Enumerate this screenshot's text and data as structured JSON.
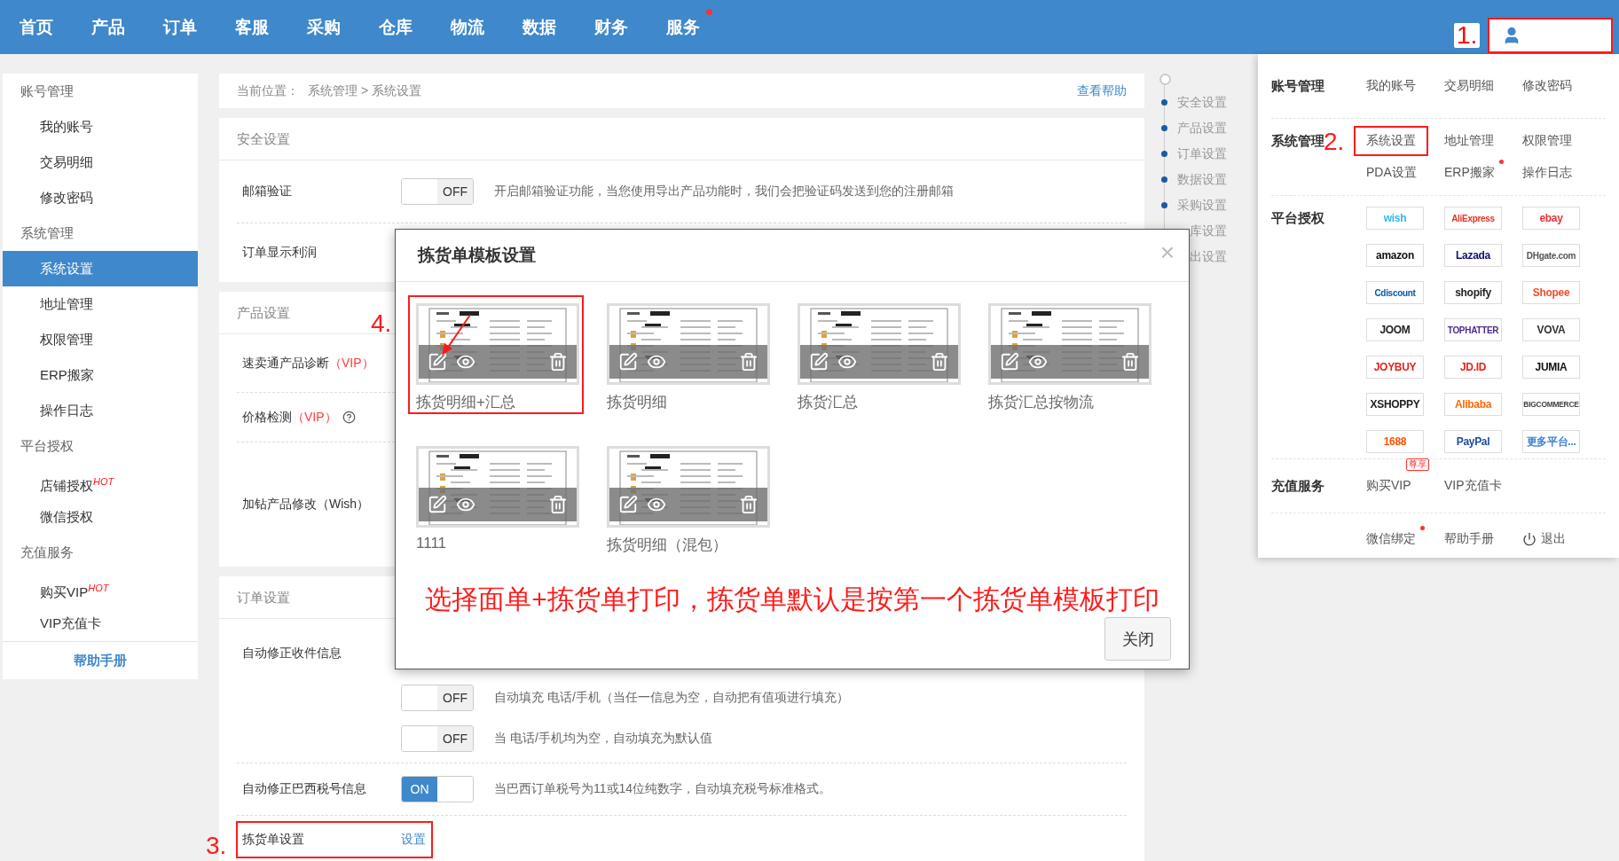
{
  "nav": {
    "items": [
      {
        "label": "首页"
      },
      {
        "label": "产品"
      },
      {
        "label": "订单"
      },
      {
        "label": "客服"
      },
      {
        "label": "采购"
      },
      {
        "label": "仓库"
      },
      {
        "label": "物流"
      },
      {
        "label": "数据"
      },
      {
        "label": "财务"
      },
      {
        "label": "服务",
        "dot": true
      }
    ],
    "user": {
      "annotation": "1."
    }
  },
  "sidebar": {
    "groups": [
      {
        "title": "账号管理",
        "items": [
          {
            "label": "我的账号",
            "selected": false
          },
          {
            "label": "交易明细",
            "selected": false
          },
          {
            "label": "修改密码",
            "selected": false
          }
        ]
      },
      {
        "title": "系统管理",
        "items": [
          {
            "label": "系统设置",
            "selected": true
          },
          {
            "label": "地址管理",
            "selected": false
          },
          {
            "label": "权限管理",
            "selected": false
          },
          {
            "label": "ERP搬家",
            "selected": false
          },
          {
            "label": "操作日志",
            "selected": false
          }
        ]
      },
      {
        "title": "平台授权",
        "items": [
          {
            "label": "店铺授权$^{HOT}$",
            "selected": false
          },
          {
            "label": "微信授权",
            "selected": false
          }
        ]
      },
      {
        "title": "充值服务",
        "items": [
          {
            "label": "购买VIP$^{HOT}$",
            "selected": false
          },
          {
            "label": "VIP充值卡",
            "selected": false
          }
        ]
      }
    ],
    "footer": "帮助手册"
  },
  "breadcrumb": {
    "prefix": "当前位置：",
    "path": "系统管理 > 系统设置",
    "help": "查看帮助"
  },
  "sections": [
    {
      "title": "安全设置",
      "rows": [
        {
          "label": "邮箱验证",
          "options": [
            {
              "toggle": {
                "on": false,
                "text": "OFF"
              },
              "description": "开启邮箱验证功能，当您使用导出产品功能时，我们会把验证码发送到您的注册邮箱"
            }
          ]
        },
        {
          "label": "订单显示利润"
        }
      ]
    },
    {
      "title": "产品设置",
      "rows": [
        {
          "label": "速卖通产品诊断",
          "tag": "（VIP）"
        },
        {
          "label": "价格检测",
          "tag": "（VIP）",
          "help": true
        },
        {
          "label": "加钻产品修改（Wish）"
        }
      ]
    },
    {
      "title": "订单设置",
      "rows": [
        {
          "label": "自动修正收件信息",
          "options": [
            {
              "toggle": {
                "on": false,
                "text": "OFF"
              },
              "description": "自动填充 电话/手机（当任一信息为空，自动把有值项进行填充）"
            },
            {
              "toggle": {
                "on": false,
                "text": "OFF"
              },
              "description": "当 电话/手机均为空，自动填充为默认值"
            }
          ]
        },
        {
          "label": "自动修正巴西税号信息",
          "options": [
            {
              "toggle": {
                "on": true,
                "text": "ON"
              },
              "description": "当巴西订单税号为11或14位纯数字，自动填充税号标准格式。"
            }
          ]
        },
        {
          "label": "拣货单设置",
          "link": "设置",
          "annotation": "3."
        }
      ]
    }
  ],
  "right_nav": {
    "items": [
      {
        "label": "安全设置",
        "covered": false
      },
      {
        "label": "产品设置",
        "covered": false
      },
      {
        "label": "订单设置",
        "covered": false
      },
      {
        "label": "数据设置",
        "covered": false
      },
      {
        "label": "采购设置",
        "covered": false
      },
      {
        "label": "库设置",
        "covered": true
      },
      {
        "label": "出设置",
        "covered": true
      }
    ]
  },
  "modal": {
    "title": "拣货单模板设置",
    "close": "×",
    "templates": [
      {
        "name": "拣货明细+汇总",
        "annotation": "4."
      },
      {
        "name": "拣货明细"
      },
      {
        "name": "拣货汇总"
      },
      {
        "name": "拣货汇总按物流"
      },
      {
        "name": "1111"
      },
      {
        "name": "拣货明细（混包）"
      }
    ],
    "note": "选择面单+拣货单打印，拣货单默认是按第一个拣货单模板打印",
    "button": "关闭"
  },
  "user_menu": {
    "sections": [
      {
        "title": "账号管理",
        "items": [
          {
            "label": "我的账号"
          },
          {
            "label": "交易明细"
          },
          {
            "label": "修改密码"
          }
        ]
      },
      {
        "title": "系统管理",
        "items": [
          {
            "label": "系统设置",
            "annotation": "2."
          },
          {
            "label": "地址管理"
          },
          {
            "label": "权限管理"
          },
          {
            "label": "PDA设置"
          },
          {
            "label": "ERP搬家",
            "dot": true
          },
          {
            "label": "操作日志"
          }
        ]
      },
      {
        "title": "平台授权",
        "kind": "logos",
        "items": [
          {
            "label": "wish",
            "color": "#2fb7ec"
          },
          {
            "label": "AliExpress",
            "color": "#e43225"
          },
          {
            "label": "ebay",
            "color": "#e53238"
          },
          {
            "label": "amazon",
            "color": "#111111"
          },
          {
            "label": "Lazada",
            "color": "#0f136d"
          },
          {
            "label": "DHgate.com",
            "color": "#555555"
          },
          {
            "label": "Cdiscount",
            "color": "#0a58a6"
          },
          {
            "label": "shopify",
            "color": "#222222"
          },
          {
            "label": "Shopee",
            "color": "#ee4d2d"
          },
          {
            "label": "JOOM",
            "color": "#222222"
          },
          {
            "label": "TOPHATTER",
            "color": "#4b2a91"
          },
          {
            "label": "VOVA",
            "color": "#333333"
          },
          {
            "label": "JOYBUY",
            "color": "#e1251b"
          },
          {
            "label": "JD.ID",
            "color": "#e1251b"
          },
          {
            "label": "JUMIA",
            "color": "#111111"
          },
          {
            "label": "XSHOPPY",
            "color": "#222222"
          },
          {
            "label": "Alibaba",
            "color": "#ff6a00"
          },
          {
            "label": "BIGCOMMERCE",
            "color": "#444444"
          },
          {
            "label": "1688",
            "color": "#ff5000"
          },
          {
            "label": "PayPal",
            "color": "#1c4b9c"
          },
          {
            "label": "更多平台...",
            "color": "#3a7fd5"
          }
        ]
      },
      {
        "title": "充值服务",
        "items": [
          {
            "label": "购买VIP",
            "badge": "尊享"
          },
          {
            "label": "VIP充值卡"
          }
        ]
      },
      {
        "items": [
          {
            "label": "微信绑定",
            "dot": true
          },
          {
            "label": "帮助手册"
          },
          {
            "label": "退出",
            "kind": "logout"
          }
        ]
      }
    ]
  }
}
